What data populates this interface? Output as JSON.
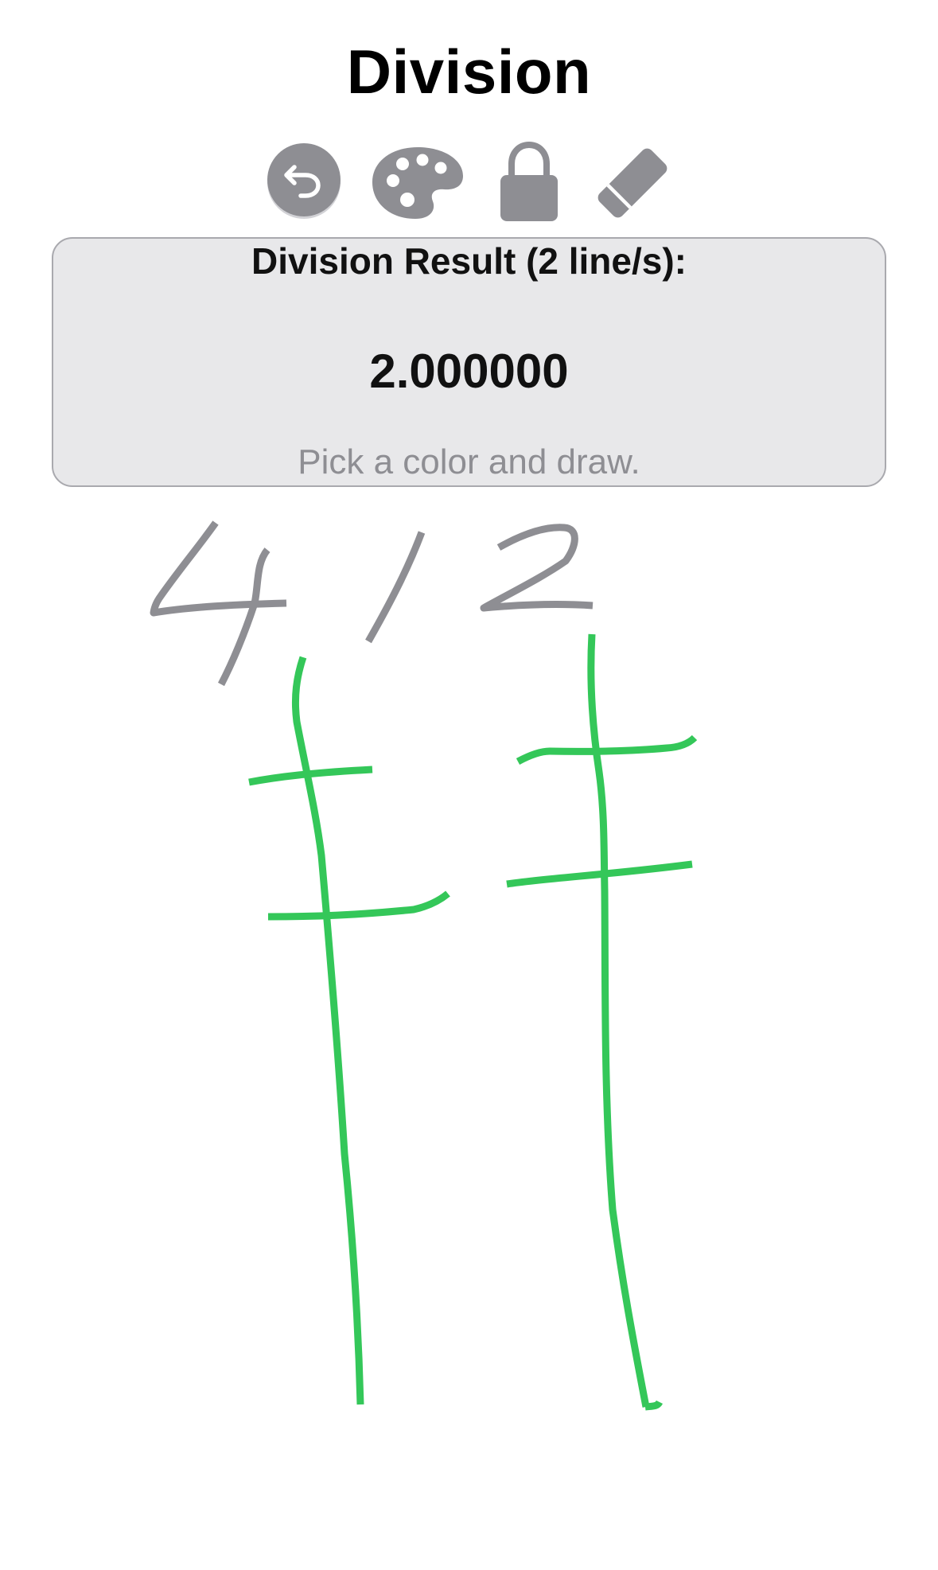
{
  "header": {
    "title": "Division"
  },
  "toolbar": {
    "icon_color": "#8e8e93",
    "tools": [
      {
        "name": "undo",
        "icon": "undo-arrow-icon"
      },
      {
        "name": "color-picker",
        "icon": "palette-icon"
      },
      {
        "name": "lock",
        "icon": "lock-icon"
      },
      {
        "name": "eraser",
        "icon": "eraser-icon"
      }
    ]
  },
  "result": {
    "heading": "Division Result (2 line/s):",
    "value": "2.000000",
    "hint": "Pick a color and draw."
  },
  "canvas": {
    "handwritten_expression_color": "#8e8e93",
    "line_color": "#34c759"
  }
}
